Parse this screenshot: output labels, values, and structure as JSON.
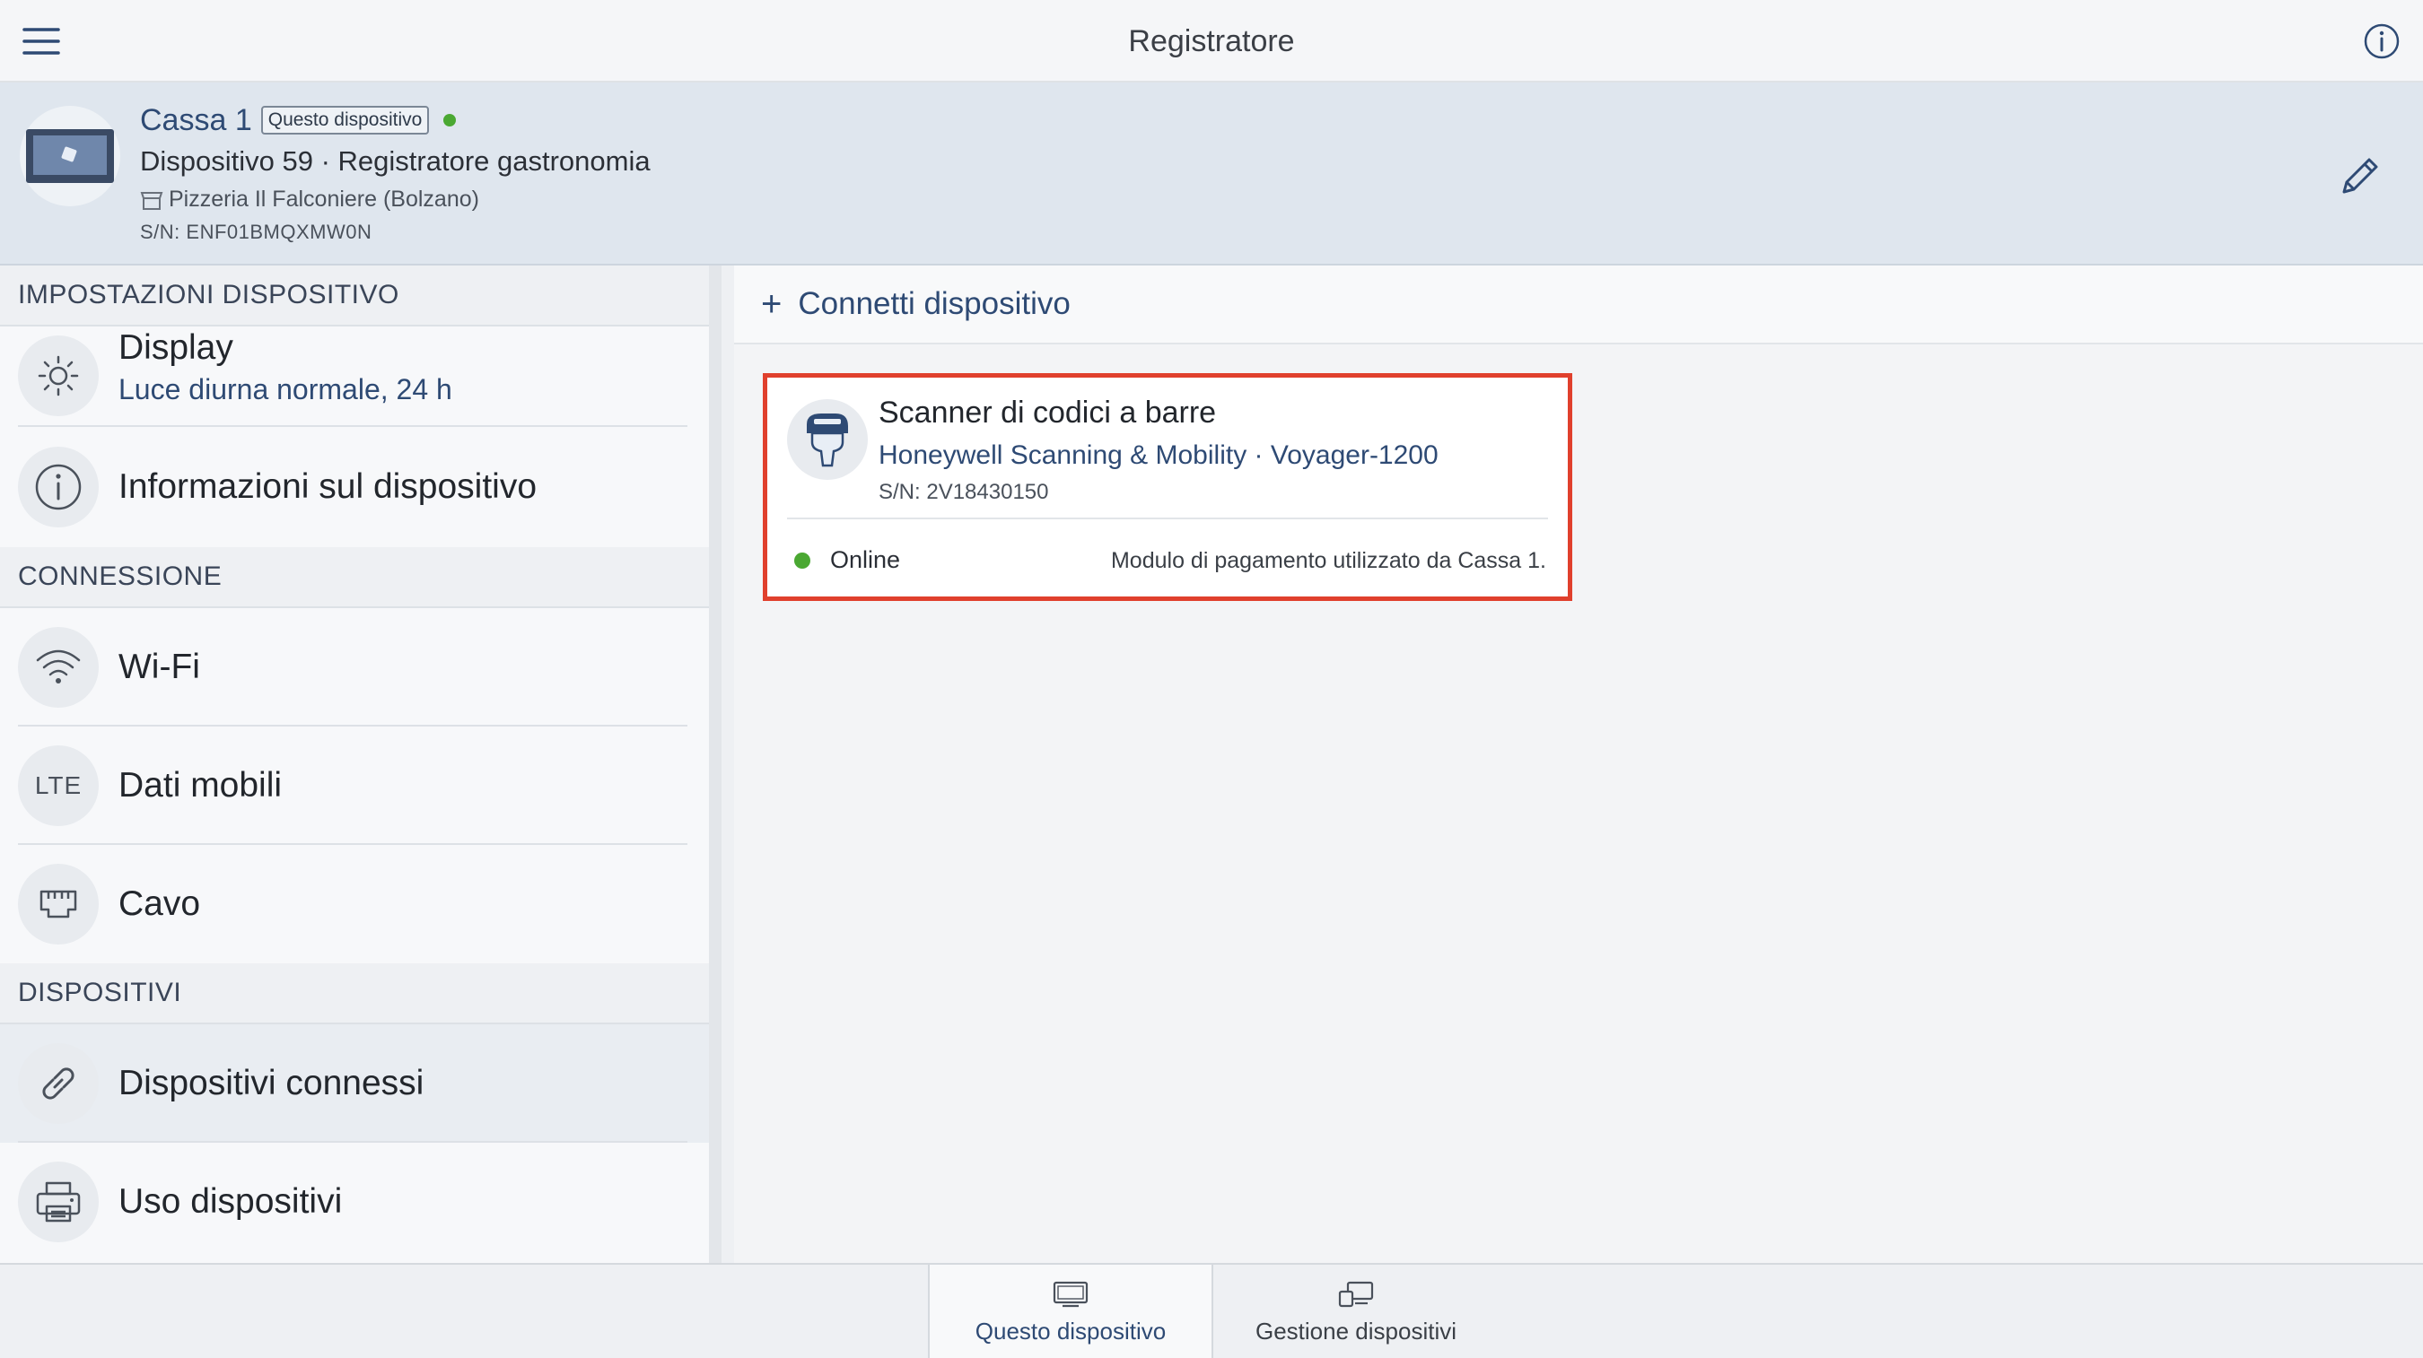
{
  "topbar": {
    "title": "Registratore"
  },
  "device": {
    "name": "Cassa 1",
    "badge": "Questo dispositivo",
    "model": "Dispositivo 59 · Registratore gastronomia",
    "location": "Pizzeria Il Falconiere (Bolzano)",
    "serial": "S/N: ENF01BMQXMW0N",
    "status_color": "#4aa832"
  },
  "sidebar": {
    "sections": [
      {
        "header": "IMPOSTAZIONI DISPOSITIVO"
      },
      {
        "header": "CONNESSIONE"
      },
      {
        "header": "DISPOSITIVI"
      }
    ],
    "items": [
      {
        "label": "Display",
        "sub": "Luce diurna normale, 24 h",
        "icon": "sun-icon"
      },
      {
        "label": "Informazioni sul dispositivo",
        "icon": "info-circle-icon"
      },
      {
        "label": "Wi-Fi",
        "icon": "wifi-icon"
      },
      {
        "label": "Dati mobili",
        "icon": "lte-icon",
        "icon_text": "LTE"
      },
      {
        "label": "Cavo",
        "icon": "ethernet-icon"
      },
      {
        "label": "Dispositivi connessi",
        "icon": "link-icon",
        "selected": true
      },
      {
        "label": "Uso dispositivi",
        "icon": "printer-icon"
      }
    ]
  },
  "content": {
    "connect_label": "Connetti dispositivo",
    "card": {
      "title": "Scanner di codici a barre",
      "maker": "Honeywell Scanning & Mobility · Voyager-1200",
      "serial": "S/N: 2V18430150",
      "status": "Online",
      "note": "Modulo di pagamento utilizzato da Cassa 1.",
      "highlight_color": "#e0402d"
    }
  },
  "bottom_tabs": [
    {
      "label": "Questo dispositivo",
      "active": true
    },
    {
      "label": "Gestione dispositivi",
      "active": false
    }
  ]
}
